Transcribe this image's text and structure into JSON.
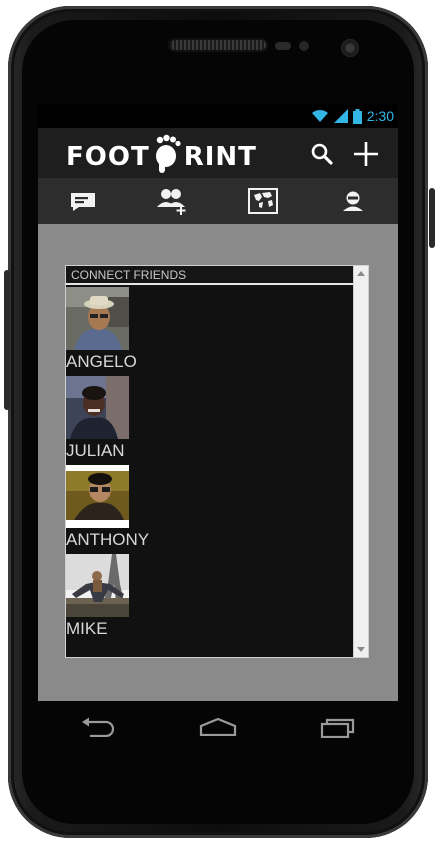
{
  "status_bar": {
    "time": "2:30",
    "accent_color": "#33b5e5"
  },
  "app": {
    "logo_left": "FOOT",
    "logo_right": "RINT",
    "icons": [
      "search-icon",
      "add-icon"
    ]
  },
  "tabs": [
    "messages-icon",
    "add-friends-icon",
    "map-icon",
    "profile-icon"
  ],
  "panel": {
    "header": "CONNECT FRIENDS",
    "friends": [
      {
        "name": "ANGELO"
      },
      {
        "name": "JULIAN"
      },
      {
        "name": "ANTHONY"
      },
      {
        "name": "MIKE"
      }
    ]
  },
  "nav": [
    "back-icon",
    "home-icon",
    "recent-apps-icon"
  ]
}
